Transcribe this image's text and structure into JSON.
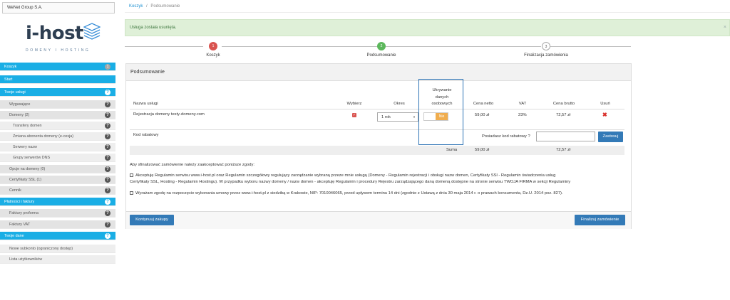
{
  "company": "WeNet Group S.A.",
  "logo": {
    "name": "i-host",
    "tagline": "DOMENY I HOSTING"
  },
  "sidebar": {
    "items": [
      {
        "label": "Koszyk",
        "badge": "1"
      },
      {
        "label": "Start"
      },
      {
        "label": "Twoje usługi",
        "icon": "question-icon"
      },
      {
        "label": "Wygasające",
        "icon": "question-icon"
      },
      {
        "label": "Domeny (2)",
        "icon": "question-icon"
      },
      {
        "label": "Transfery domen",
        "icon": "question-icon"
      },
      {
        "label": "Zmiana abonenta domeny (e-cesja)",
        "icon": "question-icon"
      },
      {
        "label": "Serwery nazw",
        "icon": "question-icon"
      },
      {
        "label": "Grupy serwerów DNS",
        "icon": "question-icon"
      },
      {
        "label": "Opcje na domeny (0)",
        "icon": "question-icon"
      },
      {
        "label": "Certyfikaty SSL (1)",
        "icon": "question-icon"
      },
      {
        "label": "Cennik",
        "icon": "question-icon"
      },
      {
        "label": "Płatności i faktury",
        "icon": "question-icon"
      },
      {
        "label": "Faktury proforma",
        "icon": "question-icon"
      },
      {
        "label": "Faktury VAT",
        "icon": "question-icon"
      },
      {
        "label": "Twoje dane",
        "icon": "question-icon"
      },
      {
        "label": "Nowe subkonto (ograniczony dostęp)"
      },
      {
        "label": "Lista użytkowników"
      }
    ]
  },
  "breadcrumb": {
    "link": "Koszyk",
    "separator": "/",
    "current": "Podsumowanie"
  },
  "alert": {
    "message": "Usługa została usunięta.",
    "close": "×"
  },
  "steps": [
    {
      "num": "1",
      "label": "Koszyk",
      "color": "#d9534f"
    },
    {
      "num": "2",
      "label": "Podsumowanie",
      "color": "#5cb85c"
    },
    {
      "num": "3",
      "label": "Finalizacja zamówienia",
      "color": "#ffffff"
    }
  ],
  "panel": {
    "title": "Podsumowanie",
    "columns": {
      "name": "Nazwa usługi",
      "select": "Wybierz",
      "period": "Okres",
      "privacy": [
        "Ukrywanie",
        "danych",
        "osobowych"
      ],
      "net": "Cena netto",
      "vat": "VAT",
      "gross": "Cena brutto",
      "delete": "Usuń"
    },
    "row": {
      "name": "Rejestracja domeny testy-domeny.com",
      "period": "1 rok",
      "privacy_on": "Nie",
      "net": "59,00 zł",
      "vat": "23%",
      "gross": "72,57 zł"
    },
    "coupon": {
      "label": "Kod rabatowy",
      "question": "Posiadasz kod rabatowy ?",
      "button": "Zastosuj"
    },
    "sum": {
      "label": "Suma",
      "net": "59,00 zł",
      "gross": "72,57 zł"
    },
    "consents": {
      "intro": "Aby sfinalizować zamówienie należy zaakceptować poniższe zgody:",
      "first_line1": "Akceptuję Regulamin serwisu www.i-host.pl oraz Regulamin szczegółowy regulujący zarządzanie wybraną przeze mnie usługą (Domeny - Regulamin rejestracji i obsługi nazw domen, Certyfikaty SSl - Regulamin świadczenia usług",
      "first_line2": "Certyfikaty SSL, Hosting - Regulamin Hostingu). W przypadku wyboru nazwy domeny / nazw domen - akceptuję Regulamin i procedury Rejestru zarządzającego daną domeną dostępne na stronie serwisu TWOJA FIRMA w sekcji Regulaminy",
      "second": "Wyrażam zgodę na rozpoczęcie wykonania umowy przez www.i-host.pl z siedzibą w Krakowie, NIP: 7010046065, przed upływem terminu 14 dni (zgodnie z Ustawą z dnia 30 maja 2014 r. o prawach konsumenta, Dz.U. 2014 poz. 827)."
    },
    "buttons": {
      "continue": "Kontynuuj zakupy",
      "finalize": "Finalizuj zamówienie"
    }
  },
  "colors": {
    "accent": "#1aaee5",
    "primary_button": "#337ab7",
    "highlight_box": "#2f74b5",
    "toggle": "#f0ad4e",
    "delete": "#d9302c"
  }
}
